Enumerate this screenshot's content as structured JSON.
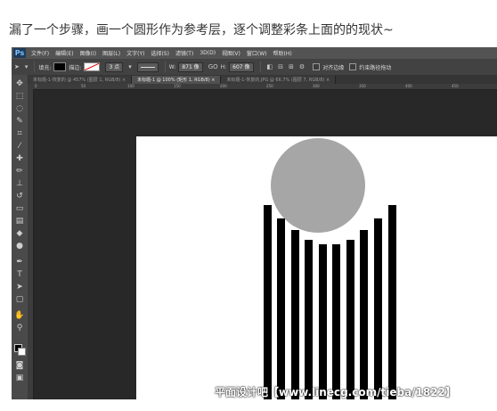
{
  "post": {
    "caption": "漏了一个步骤，画一个圆形作为参考层，逐个调整彩条上面的的现状~"
  },
  "app": {
    "logo": "Ps",
    "menu": [
      "文件(F)",
      "编辑(E)",
      "图像(I)",
      "图层(L)",
      "文字(Y)",
      "选择(S)",
      "滤镜(T)",
      "3D(D)",
      "视图(V)",
      "窗口(W)",
      "帮助(H)"
    ]
  },
  "options": {
    "fill_label": "填充:",
    "stroke_label": "描边:",
    "stroke_width": "3 点",
    "w_label": "W:",
    "w_value": "871 像",
    "link_symbol": "GO",
    "h_label": "H:",
    "h_value": "607 像",
    "align_edges": "对齐边缘",
    "constrain_path": "约束路径拖动"
  },
  "tabs": [
    {
      "label": "未标题-1-恢复的 @ 457% (图层 1, RGB/8) ×",
      "active": false
    },
    {
      "label": "未标题-1 @ 100% (矩形 1, RGB/8) ×",
      "active": true
    },
    {
      "label": "未标题-1-恢复的.JPG @ 66.7% (图层 7, RGB/8) ×",
      "active": false
    }
  ],
  "ruler_labels": [
    "0",
    "50",
    "100",
    "150",
    "200",
    "250",
    "300",
    "350",
    "400",
    "450"
  ],
  "colors": {
    "workspace": "#282828",
    "document": "#ffffff",
    "circle": "#a6a6a6",
    "stripes": "#000000"
  },
  "tool_icons": [
    "move-icon",
    "marquee-icon",
    "lasso-icon",
    "quick-select-icon",
    "crop-icon",
    "eyedropper-icon",
    "healing-icon",
    "brush-icon",
    "stamp-icon",
    "history-brush-icon",
    "eraser-icon",
    "gradient-icon",
    "blur-icon",
    "dodge-icon",
    "pen-icon",
    "type-icon",
    "path-select-icon",
    "shape-icon",
    "hand-icon",
    "zoom-icon"
  ],
  "watermark": "平面设计吧【www.linecg.com/tieba/1822】"
}
